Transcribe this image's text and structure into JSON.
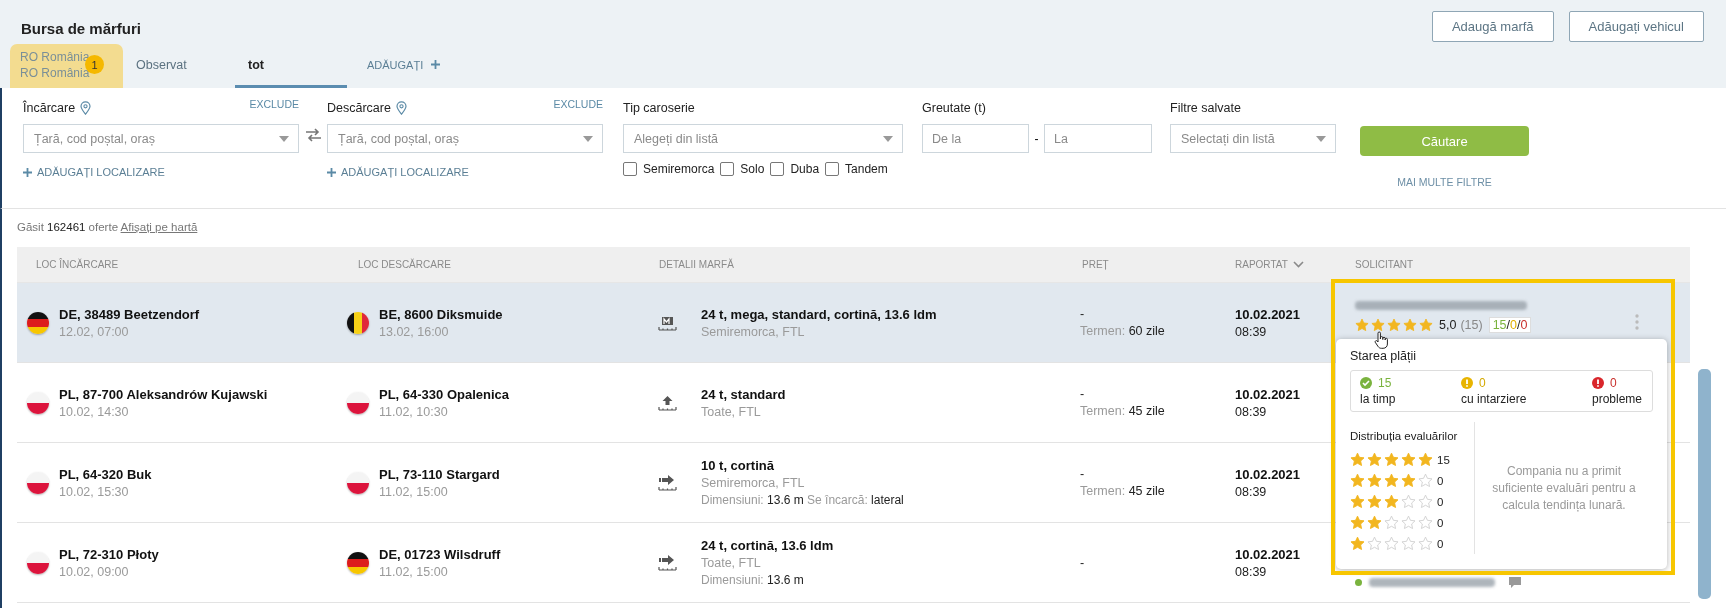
{
  "page": {
    "title": "Bursa de mărfuri"
  },
  "header_buttons": [
    "Adaugă marfă",
    "Adăugați vehicul"
  ],
  "tabs": [
    {
      "kind": "saved",
      "lines": [
        "RO România",
        "RO România"
      ],
      "badge": "1",
      "selected": false
    },
    {
      "kind": "plain",
      "label": "Observat",
      "selected": false
    },
    {
      "kind": "plain",
      "label": "tot",
      "selected": true
    },
    {
      "kind": "add",
      "label": "ADĂUGAȚI",
      "selected": false
    }
  ],
  "filters": {
    "loading": {
      "label": "Încărcare",
      "exclude": "EXCLUDE",
      "placeholder": "Țară, cod poștal, oraș",
      "add_link": "ADĂUGAȚI LOCALIZARE"
    },
    "unloading": {
      "label": "Descărcare",
      "exclude": "EXCLUDE",
      "placeholder": "Țară, cod poștal, oraș",
      "add_link": "ADĂUGAȚI LOCALIZARE"
    },
    "body_type": {
      "label": "Tip caroserie",
      "placeholder": "Alegeți din listă",
      "options": [
        {
          "label": "Semiremorca",
          "checked": false
        },
        {
          "label": "Solo",
          "checked": false
        },
        {
          "label": "Duba",
          "checked": false
        },
        {
          "label": "Tandem",
          "checked": false
        }
      ]
    },
    "weight": {
      "label": "Greutate (t)",
      "from_placeholder": "De la",
      "separator": "-",
      "to_placeholder": "La"
    },
    "saved": {
      "label": "Filtre salvate",
      "placeholder": "Selectați din listă"
    },
    "search_button": "Căutare",
    "more_filters": "MAI MULTE FILTRE"
  },
  "results": {
    "prefix": "Găsit",
    "count": "162461",
    "suffix": "oferte",
    "map_link": "Afișați pe hartă"
  },
  "table": {
    "columns": [
      {
        "label": "LOC ÎNCĂRCARE",
        "sorted": false
      },
      {
        "label": "LOC DESCĂRCARE",
        "sorted": false
      },
      {
        "label": "DETALII MARFĂ",
        "sorted": false
      },
      {
        "label": "PREȚ",
        "sorted": false
      },
      {
        "label": "RAPORTAT",
        "sorted": true
      },
      {
        "label": "SOLICITANT",
        "sorted": false
      }
    ],
    "rows": [
      {
        "selected": true,
        "load": {
          "kind": "de",
          "place": "DE, 38489 Beetzendorf",
          "date": "12.02, 07:00"
        },
        "unload": {
          "kind": "be",
          "place": "BE, 8600 Diksmuide",
          "date": "13.02, 16:00"
        },
        "cargo": {
          "kind": "mega",
          "title": "24 t, mega, standard, cortină, 13.6 ldm",
          "subtitle": "Semiremorca, FTL"
        },
        "price": {
          "value": "-",
          "term_label": "Termen:",
          "term_value": "60 zile"
        },
        "reported": {
          "date": "10.02.2021",
          "time": "08:39"
        },
        "requester": {
          "stars": 5,
          "rating": "5,0",
          "reviews": "(15)",
          "payments": [
            "15",
            "0",
            "0"
          ],
          "payment_separators": [
            "/",
            "/"
          ]
        }
      },
      {
        "selected": false,
        "load": {
          "kind": "pl",
          "place": "PL, 87-700 Aleksandrów Kujawski",
          "date": "10.02, 14:30"
        },
        "unload": {
          "kind": "pl",
          "place": "PL, 64-330 Opalenica",
          "date": "11.02, 10:30"
        },
        "cargo": {
          "kind": "top",
          "title": "24 t, standard",
          "subtitle": "Toate, FTL"
        },
        "price": {
          "value": "-",
          "term_label": "Termen:",
          "term_value": "45 zile"
        },
        "reported": {
          "date": "10.02.2021",
          "time": "08:39"
        }
      },
      {
        "selected": false,
        "load": {
          "kind": "pl",
          "place": "PL, 64-320 Buk",
          "date": "10.02, 15:30"
        },
        "unload": {
          "kind": "pl",
          "place": "PL, 73-110 Stargard",
          "date": "11.02, 15:00"
        },
        "cargo": {
          "kind": "side",
          "title": "10 t, cortină",
          "subtitle": "Semiremorca, FTL",
          "details": [
            {
              "label": "Dimensiuni:",
              "value": "13.6 m"
            },
            {
              "label": "Se încarcă:",
              "value": "lateral"
            }
          ]
        },
        "price": {
          "value": "-",
          "term_label": "Termen:",
          "term_value": "45 zile"
        },
        "reported": {
          "date": "10.02.2021",
          "time": "08:39"
        }
      },
      {
        "selected": false,
        "load": {
          "kind": "pl",
          "place": "PL, 72-310 Płoty",
          "date": "10.02, 09:00"
        },
        "unload": {
          "kind": "de",
          "place": "DE, 01723 Wilsdruff",
          "date": "11.02, 15:00"
        },
        "cargo": {
          "kind": "side",
          "title": "24 t, cortină, 13.6 ldm",
          "subtitle": "Toate, FTL",
          "details": [
            {
              "label": "Dimensiuni:",
              "value": "13.6 m"
            }
          ]
        },
        "price": {
          "value": "-"
        },
        "reported": {
          "date": "10.02.2021",
          "time": "08:39"
        },
        "requester": {
          "online": true
        }
      }
    ]
  },
  "popup": {
    "title": "Starea plății",
    "payment": [
      {
        "kind": "ok",
        "count": "15",
        "label": "la timp"
      },
      {
        "kind": "late",
        "count": "0",
        "label": "cu intarziere"
      },
      {
        "kind": "problem",
        "count": "0",
        "label": "probleme"
      }
    ],
    "distribution_title": "Distribuția evaluărilor",
    "distribution": [
      {
        "stars": 5,
        "count": "15"
      },
      {
        "stars": 4,
        "count": "0"
      },
      {
        "stars": 3,
        "count": "0"
      },
      {
        "stars": 2,
        "count": "0"
      },
      {
        "stars": 1,
        "count": "0"
      }
    ],
    "trend_note": "Compania nu a primit suficiente evaluări pentru a calcula tendința lunară."
  }
}
